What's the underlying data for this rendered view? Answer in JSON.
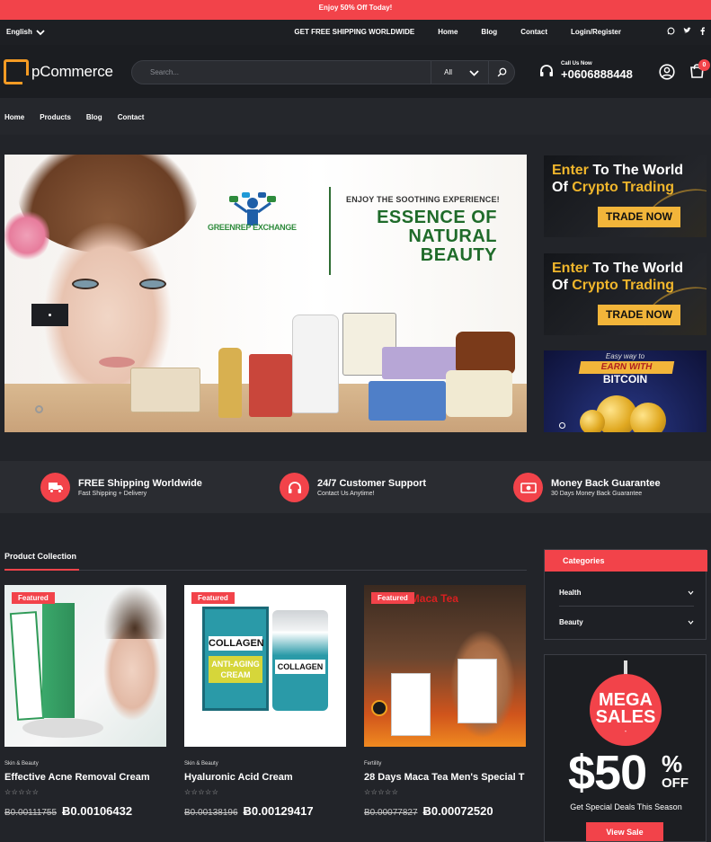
{
  "promo": {
    "text": "Enjoy 50% Off Today!"
  },
  "topbar": {
    "language": "English",
    "shipping": "GET FREE SHIPPING WORLDWIDE",
    "links": [
      "Home",
      "Blog",
      "Contact",
      "Login/Register"
    ],
    "social_icons": [
      "whatsapp-icon",
      "twitter-icon",
      "facebook-icon"
    ]
  },
  "header": {
    "logo_text": "pCommerce",
    "search": {
      "placeholder": "Search...",
      "category": "All"
    },
    "call_label": "Call Us Now",
    "phone": "+0606888448",
    "cart_count": "0"
  },
  "mainnav": {
    "items": [
      "Home",
      "Products",
      "Blog",
      "Contact"
    ]
  },
  "hero": {
    "kicker": "ENJOY THE SOOTHING EXPERIENCE!",
    "title": "ESSENCE OF NATURAL BEAUTY",
    "brand": "GREENREP EXCHANGE"
  },
  "side_banners": [
    {
      "line1_a": "Enter",
      "line1_b": " To The World",
      "line2_a": "Of ",
      "line2_b": "Crypto Trading",
      "button": "TRADE NOW"
    },
    {
      "line1_a": "Enter",
      "line1_b": " To The World",
      "line2_a": "Of ",
      "line2_b": "Crypto Trading",
      "button": "TRADE NOW"
    }
  ],
  "btc_banner": {
    "top": "Easy way to",
    "ribbon": "EARN WITH",
    "word": "BITCOIN"
  },
  "features": [
    {
      "title": "FREE Shipping Worldwide",
      "subtitle": "Fast Shipping + Delivery",
      "icon": "truck-icon"
    },
    {
      "title": "24/7 Customer Support",
      "subtitle": "Contact Us Anytime!",
      "icon": "headset-icon"
    },
    {
      "title": "Money Back Guarantee",
      "subtitle": "30 Days Money Back Guarantee",
      "icon": "money-icon"
    }
  ],
  "collection": {
    "title": "Product Collection",
    "products": [
      {
        "badge": "Featured",
        "category": "Skin & Beauty",
        "name": "Effective Acne Removal Cream",
        "rating": "☆☆☆☆☆",
        "price_old": "Ƀ0.00111755",
        "price_new": "Ƀ0.00106432"
      },
      {
        "badge": "Featured",
        "category": "Skin & Beauty",
        "name": "Hyaluronic Acid Cream",
        "rating": "☆☆☆☆☆",
        "price_old": "Ƀ0.00138196",
        "price_new": "Ƀ0.00129417"
      },
      {
        "badge": "Featured",
        "category": "Fertility",
        "name": "28 Days Maca Tea Men's Special T",
        "rating": "☆☆☆☆☆",
        "price_old": "Ƀ0.00077827",
        "price_new": "Ƀ0.00072520"
      }
    ],
    "product_labels": {
      "collagen": "COLLAGEN",
      "anti_aging": "ANTI-AGING CREAM",
      "maca": "BFTOX Maca Tea"
    }
  },
  "categories": {
    "title": "Categories",
    "items": [
      "Health",
      "Beauty"
    ]
  },
  "mega": {
    "word1": "MEGA",
    "word2": "SALES",
    "dash": "-",
    "amount": "$50",
    "pct": "%",
    "off": "OFF",
    "subtitle": "Get Special Deals This Season",
    "button": "View Sale"
  },
  "colors": {
    "accent": "#f2434a",
    "gold": "#f0b62c",
    "bg": "#222429"
  }
}
